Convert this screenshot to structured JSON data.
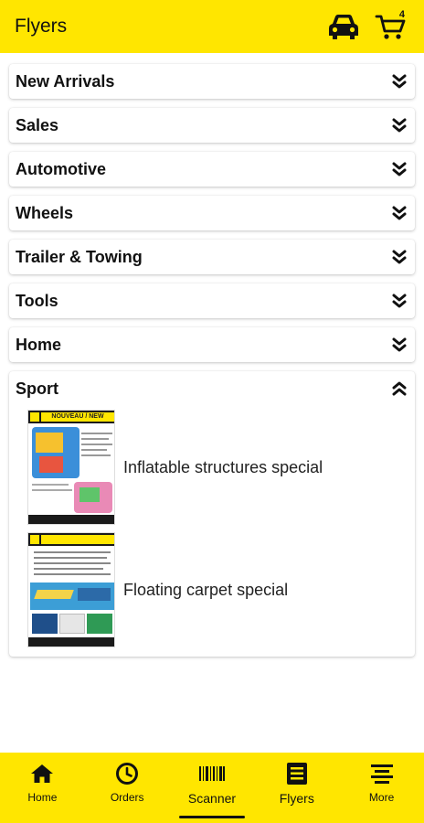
{
  "header": {
    "title": "Flyers",
    "vehicle_icon": "car-icon",
    "cart_icon": "cart-icon",
    "cart_count": "4"
  },
  "categories": [
    {
      "label": "New Arrivals",
      "expanded": false
    },
    {
      "label": "Sales",
      "expanded": false
    },
    {
      "label": "Automotive",
      "expanded": false
    },
    {
      "label": "Wheels",
      "expanded": false
    },
    {
      "label": "Trailer & Towing",
      "expanded": false
    },
    {
      "label": "Tools",
      "expanded": false
    },
    {
      "label": "Home",
      "expanded": false
    },
    {
      "label": "Sport",
      "expanded": true
    }
  ],
  "sport_flyers": [
    {
      "title": "Inflatable structures special",
      "thumb_heading": "NOUVEAU / NEW"
    },
    {
      "title": "Floating carpet special"
    }
  ],
  "bottom_nav": [
    {
      "label": "Home",
      "icon": "home-icon"
    },
    {
      "label": "Orders",
      "icon": "clock-icon"
    },
    {
      "label": "Scanner",
      "icon": "barcode-icon",
      "active": true
    },
    {
      "label": "Flyers",
      "icon": "flyer-icon"
    },
    {
      "label": "More",
      "icon": "menu-icon"
    }
  ],
  "colors": {
    "brand_yellow": "#ffe600",
    "text": "#111111"
  }
}
